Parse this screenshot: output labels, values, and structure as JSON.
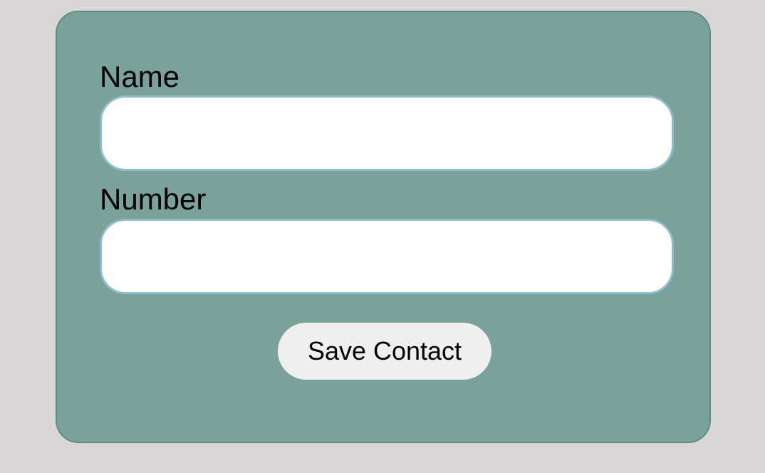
{
  "form": {
    "name_label": "Name",
    "name_value": "",
    "name_placeholder": "",
    "number_label": "Number",
    "number_value": "",
    "number_placeholder": "",
    "save_label": "Save Contact"
  },
  "colors": {
    "page_background": "#d8d6d7",
    "card_background": "#7aa19a",
    "input_border": "#8fbccc",
    "button_background": "#efefef"
  }
}
